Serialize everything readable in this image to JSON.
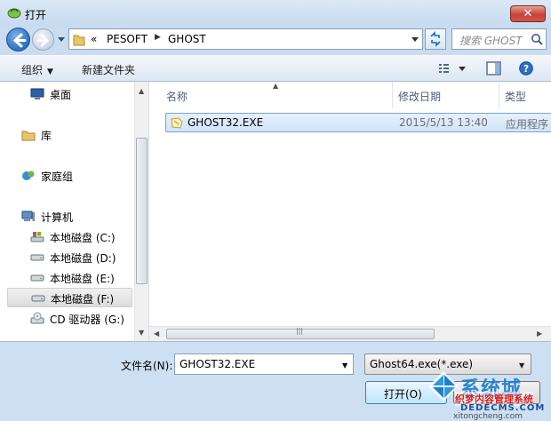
{
  "window": {
    "title": "打开",
    "close_label": "✕"
  },
  "address_bar": {
    "prefix": "«",
    "segments": [
      "PESOFT",
      "GHOST"
    ]
  },
  "search": {
    "placeholder": "搜索 GHOST"
  },
  "toolbar": {
    "organize": "组织",
    "new_folder": "新建文件夹"
  },
  "nav_pane": {
    "items": [
      {
        "label": "桌面",
        "icon": "desktop-icon"
      },
      {
        "label": "库",
        "icon": "library-icon"
      },
      {
        "label": "家庭组",
        "icon": "homegroup-icon"
      },
      {
        "label": "计算机",
        "icon": "computer-icon"
      },
      {
        "label": "本地磁盘 (C:)",
        "icon": "system-drive-icon"
      },
      {
        "label": "本地磁盘 (D:)",
        "icon": "drive-icon"
      },
      {
        "label": "本地磁盘 (E:)",
        "icon": "drive-icon"
      },
      {
        "label": "本地磁盘 (F:)",
        "icon": "drive-icon",
        "selected": true
      },
      {
        "label": "CD 驱动器 (G:)",
        "icon": "cd-drive-icon"
      }
    ]
  },
  "file_list": {
    "columns": [
      "名称",
      "修改日期",
      "类型"
    ],
    "rows": [
      {
        "name": "GHOST32.EXE",
        "modified": "2015/5/13 13:40",
        "type": "应用程序",
        "selected": true
      }
    ]
  },
  "footer": {
    "filename_label": "文件名(N):",
    "filename_value": "GHOST32.EXE",
    "filter_value": "Ghost64.exe(*.exe)",
    "open_label": "打开(O)"
  },
  "watermark": {
    "brand": "系统城",
    "slogan": "织梦内容管理系统",
    "site": "DEDECMS.COM",
    "url": "xitongcheng.com"
  },
  "colors": {
    "selection": "#cfe5fa",
    "accent": "#1b7fd0"
  }
}
